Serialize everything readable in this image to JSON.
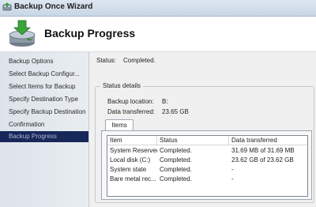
{
  "window": {
    "title": "Backup Once Wizard"
  },
  "header": {
    "title": "Backup Progress",
    "icon": "backup-drive-icon"
  },
  "sidebar": {
    "items": [
      {
        "label": "Backup Options"
      },
      {
        "label": "Select Backup Configur..."
      },
      {
        "label": "Select Items for Backup"
      },
      {
        "label": "Specify Destination Type"
      },
      {
        "label": "Specify Backup Destination"
      },
      {
        "label": "Confirmation"
      },
      {
        "label": "Backup Progress",
        "active": true
      }
    ]
  },
  "status": {
    "label": "Status:",
    "value": "Completed."
  },
  "details": {
    "legend": "Status details",
    "location_label": "Backup location:",
    "location_value": "B:",
    "transferred_label": "Data transferred:",
    "transferred_value": "23.65 GB",
    "tab_label": "Items",
    "table": {
      "headers": [
        "Item",
        "Status",
        "Data transferred"
      ],
      "rows": [
        [
          "System Reserved",
          "Completed.",
          "31.69 MB of 31.69 MB"
        ],
        [
          "Local disk (C:)",
          "Completed.",
          "23.62 GB of 23.62 GB"
        ],
        [
          "System state",
          "Completed.",
          "-"
        ],
        [
          "Bare metal rec...",
          "Completed.",
          "-"
        ]
      ]
    }
  },
  "colors": {
    "active_sidebar": "#17275a",
    "sidebar_bg": "#dde3ea",
    "content_bg": "#f0f0f0"
  }
}
